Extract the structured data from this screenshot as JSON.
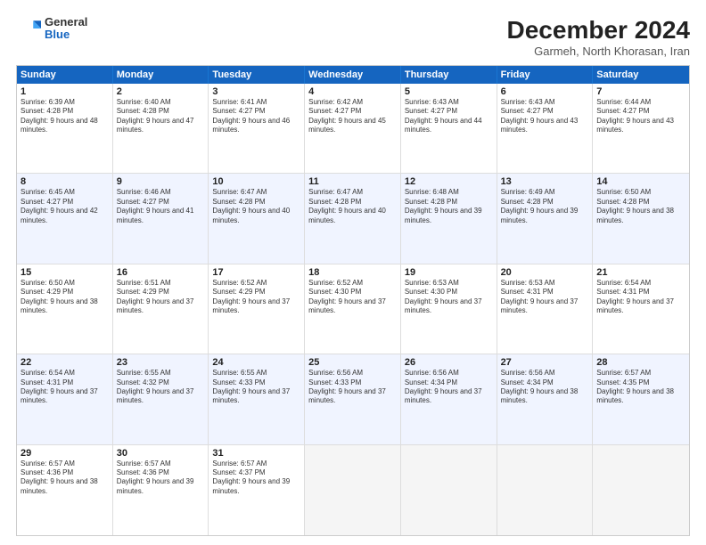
{
  "logo": {
    "general": "General",
    "blue": "Blue"
  },
  "title": "December 2024",
  "location": "Garmeh, North Khorasan, Iran",
  "days_of_week": [
    "Sunday",
    "Monday",
    "Tuesday",
    "Wednesday",
    "Thursday",
    "Friday",
    "Saturday"
  ],
  "weeks": [
    [
      {
        "day": "1",
        "sunrise": "6:39 AM",
        "sunset": "4:28 PM",
        "daylight": "9 hours and 48 minutes."
      },
      {
        "day": "2",
        "sunrise": "6:40 AM",
        "sunset": "4:28 PM",
        "daylight": "9 hours and 47 minutes."
      },
      {
        "day": "3",
        "sunrise": "6:41 AM",
        "sunset": "4:27 PM",
        "daylight": "9 hours and 46 minutes."
      },
      {
        "day": "4",
        "sunrise": "6:42 AM",
        "sunset": "4:27 PM",
        "daylight": "9 hours and 45 minutes."
      },
      {
        "day": "5",
        "sunrise": "6:43 AM",
        "sunset": "4:27 PM",
        "daylight": "9 hours and 44 minutes."
      },
      {
        "day": "6",
        "sunrise": "6:43 AM",
        "sunset": "4:27 PM",
        "daylight": "9 hours and 43 minutes."
      },
      {
        "day": "7",
        "sunrise": "6:44 AM",
        "sunset": "4:27 PM",
        "daylight": "9 hours and 43 minutes."
      }
    ],
    [
      {
        "day": "8",
        "sunrise": "6:45 AM",
        "sunset": "4:27 PM",
        "daylight": "9 hours and 42 minutes."
      },
      {
        "day": "9",
        "sunrise": "6:46 AM",
        "sunset": "4:27 PM",
        "daylight": "9 hours and 41 minutes."
      },
      {
        "day": "10",
        "sunrise": "6:47 AM",
        "sunset": "4:28 PM",
        "daylight": "9 hours and 40 minutes."
      },
      {
        "day": "11",
        "sunrise": "6:47 AM",
        "sunset": "4:28 PM",
        "daylight": "9 hours and 40 minutes."
      },
      {
        "day": "12",
        "sunrise": "6:48 AM",
        "sunset": "4:28 PM",
        "daylight": "9 hours and 39 minutes."
      },
      {
        "day": "13",
        "sunrise": "6:49 AM",
        "sunset": "4:28 PM",
        "daylight": "9 hours and 39 minutes."
      },
      {
        "day": "14",
        "sunrise": "6:50 AM",
        "sunset": "4:28 PM",
        "daylight": "9 hours and 38 minutes."
      }
    ],
    [
      {
        "day": "15",
        "sunrise": "6:50 AM",
        "sunset": "4:29 PM",
        "daylight": "9 hours and 38 minutes."
      },
      {
        "day": "16",
        "sunrise": "6:51 AM",
        "sunset": "4:29 PM",
        "daylight": "9 hours and 37 minutes."
      },
      {
        "day": "17",
        "sunrise": "6:52 AM",
        "sunset": "4:29 PM",
        "daylight": "9 hours and 37 minutes."
      },
      {
        "day": "18",
        "sunrise": "6:52 AM",
        "sunset": "4:30 PM",
        "daylight": "9 hours and 37 minutes."
      },
      {
        "day": "19",
        "sunrise": "6:53 AM",
        "sunset": "4:30 PM",
        "daylight": "9 hours and 37 minutes."
      },
      {
        "day": "20",
        "sunrise": "6:53 AM",
        "sunset": "4:31 PM",
        "daylight": "9 hours and 37 minutes."
      },
      {
        "day": "21",
        "sunrise": "6:54 AM",
        "sunset": "4:31 PM",
        "daylight": "9 hours and 37 minutes."
      }
    ],
    [
      {
        "day": "22",
        "sunrise": "6:54 AM",
        "sunset": "4:31 PM",
        "daylight": "9 hours and 37 minutes."
      },
      {
        "day": "23",
        "sunrise": "6:55 AM",
        "sunset": "4:32 PM",
        "daylight": "9 hours and 37 minutes."
      },
      {
        "day": "24",
        "sunrise": "6:55 AM",
        "sunset": "4:33 PM",
        "daylight": "9 hours and 37 minutes."
      },
      {
        "day": "25",
        "sunrise": "6:56 AM",
        "sunset": "4:33 PM",
        "daylight": "9 hours and 37 minutes."
      },
      {
        "day": "26",
        "sunrise": "6:56 AM",
        "sunset": "4:34 PM",
        "daylight": "9 hours and 37 minutes."
      },
      {
        "day": "27",
        "sunrise": "6:56 AM",
        "sunset": "4:34 PM",
        "daylight": "9 hours and 38 minutes."
      },
      {
        "day": "28",
        "sunrise": "6:57 AM",
        "sunset": "4:35 PM",
        "daylight": "9 hours and 38 minutes."
      }
    ],
    [
      {
        "day": "29",
        "sunrise": "6:57 AM",
        "sunset": "4:36 PM",
        "daylight": "9 hours and 38 minutes."
      },
      {
        "day": "30",
        "sunrise": "6:57 AM",
        "sunset": "4:36 PM",
        "daylight": "9 hours and 39 minutes."
      },
      {
        "day": "31",
        "sunrise": "6:57 AM",
        "sunset": "4:37 PM",
        "daylight": "9 hours and 39 minutes."
      },
      null,
      null,
      null,
      null
    ]
  ]
}
